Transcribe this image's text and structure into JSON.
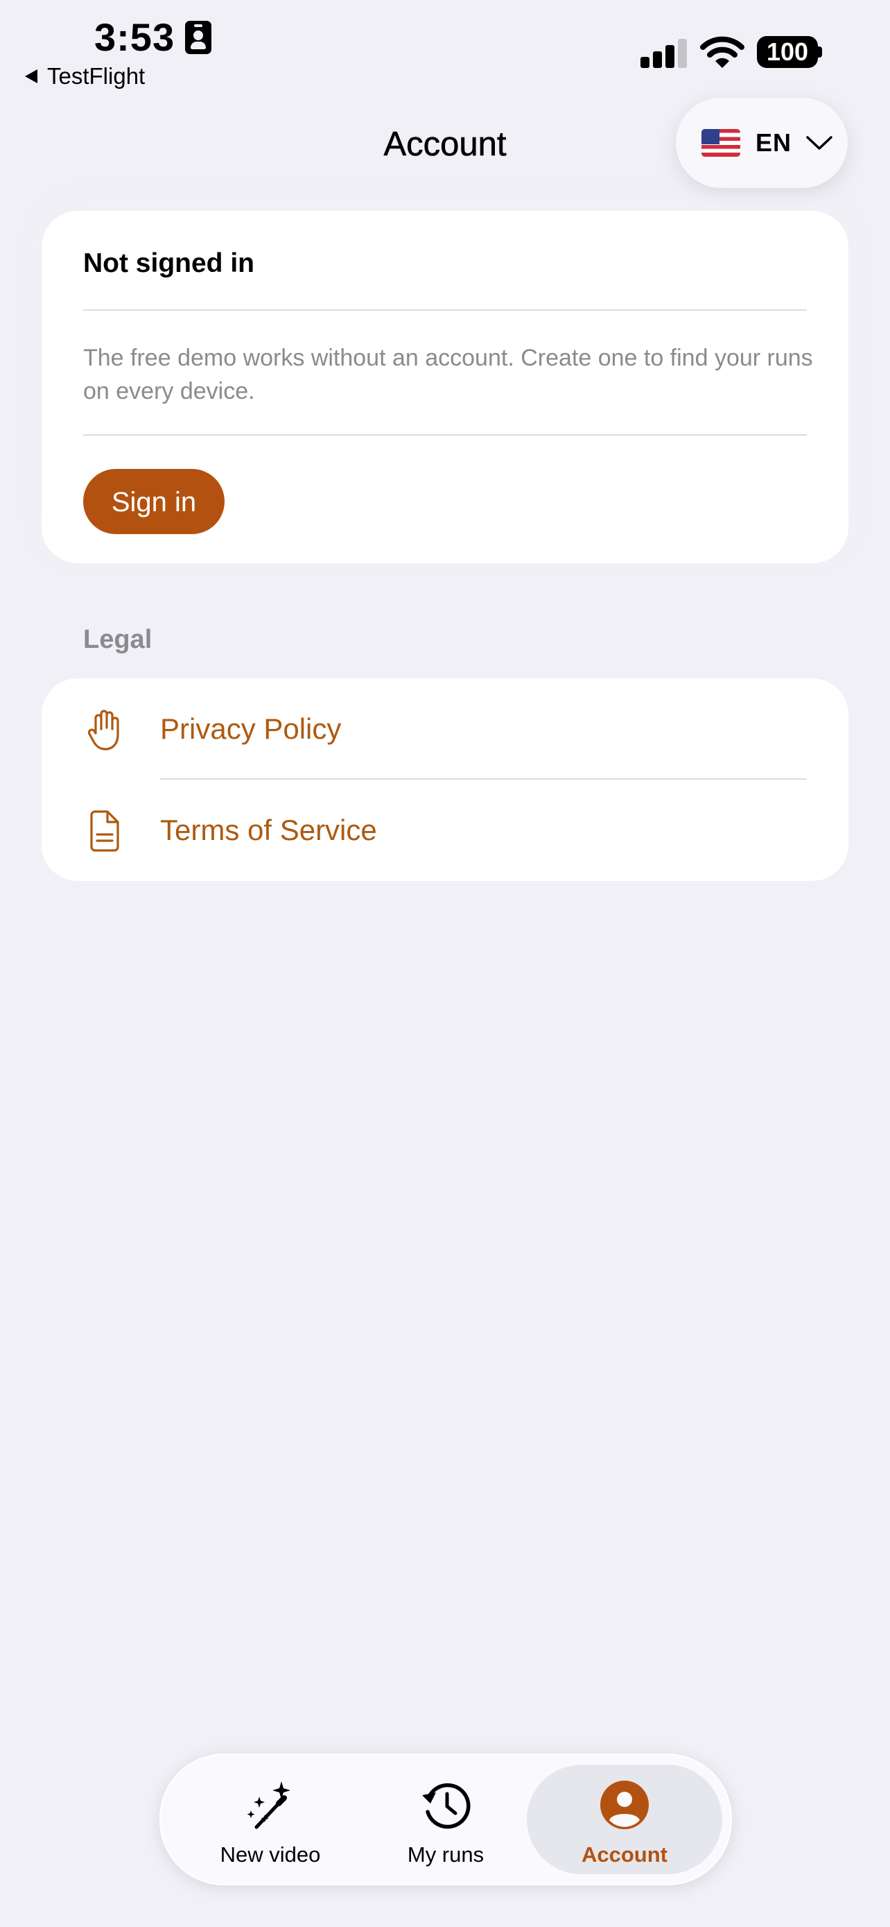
{
  "status_bar": {
    "time": "3:53",
    "back_label": "TestFlight",
    "battery": "100"
  },
  "header": {
    "title": "Account",
    "language_code": "EN"
  },
  "account_card": {
    "status": "Not signed in",
    "description": "The free demo works without an account. Create one to find your runs on every device.",
    "sign_in_label": "Sign in"
  },
  "legal": {
    "section_label": "Legal",
    "items": [
      {
        "label": "Privacy Policy",
        "icon": "hand-raised-icon"
      },
      {
        "label": "Terms of Service",
        "icon": "document-icon"
      }
    ]
  },
  "tab_bar": {
    "items": [
      {
        "label": "New video",
        "icon": "magic-wand-icon",
        "active": false
      },
      {
        "label": "My runs",
        "icon": "history-clock-icon",
        "active": false
      },
      {
        "label": "Account",
        "icon": "person-circle-icon",
        "active": true
      }
    ]
  },
  "colors": {
    "background": "#f1f0f6",
    "accent": "#b35210",
    "link": "#ad5a12",
    "secondary_text": "#8a8a8f"
  }
}
